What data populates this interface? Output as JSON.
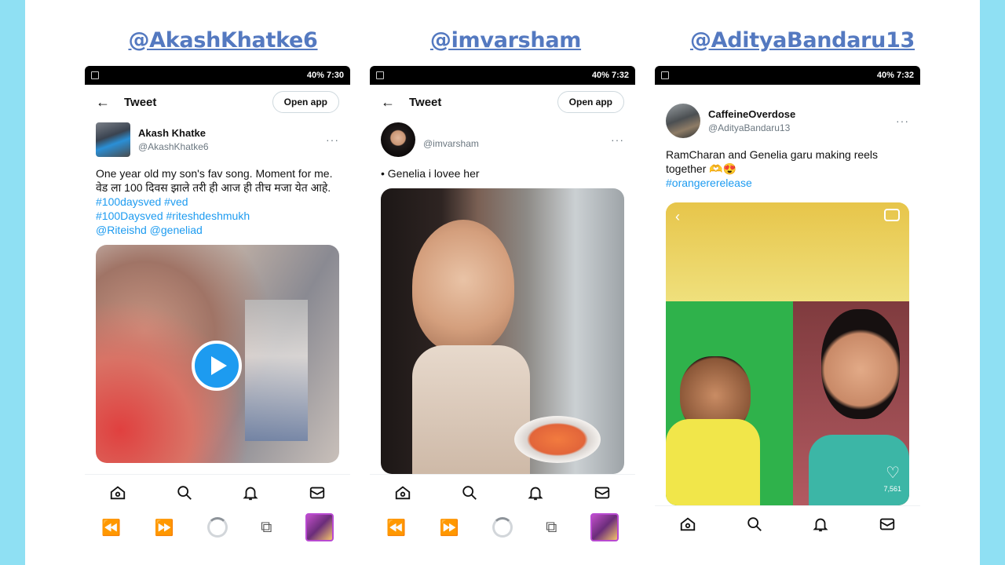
{
  "handles": [
    "@AkashKhatke6",
    "@imvarsham",
    "@AdityaBandaru13"
  ],
  "statusbars": [
    {
      "right": "40% 7:30"
    },
    {
      "right": "40% 7:32"
    },
    {
      "right": "40% 7:32"
    }
  ],
  "phone1": {
    "title": "Tweet",
    "open_app": "Open app",
    "author_name": "Akash Khatke",
    "author_user": "@AkashKhatke6",
    "text_plain": "One year old my son's fav song.  Moment for me.",
    "text_marathi": "वेड ला 100 दिवस झाले तरी ही आज ही तीच मजा येत आहे.",
    "tags_line1": "#100daysved  #ved",
    "tags_line2": "#100Daysved #riteshdeshmukh",
    "tags_line3": "@Riteishd @geneliad"
  },
  "phone2": {
    "title": "Tweet",
    "open_app": "Open app",
    "author_user": "@imvarsham",
    "text": "• Genelia i lovee her"
  },
  "phone3": {
    "author_name": "CaffeineOverdose",
    "author_user": "@AdityaBandaru13",
    "text": "RamCharan and Genelia garu making reels together 🫶😍",
    "tag": "#orangererelease",
    "like_count": "7,561"
  },
  "icons": {
    "back": "arrow-left-icon",
    "more": "more-horizontal-icon",
    "home": "home-icon",
    "search": "search-icon",
    "notifications": "bell-icon",
    "messages": "mail-icon",
    "play": "play-icon",
    "camera": "camera-icon",
    "heart": "heart-icon"
  },
  "colors": {
    "accent": "#1d9bf0",
    "handle": "#5479c0",
    "frame": "#8fe0f3"
  }
}
